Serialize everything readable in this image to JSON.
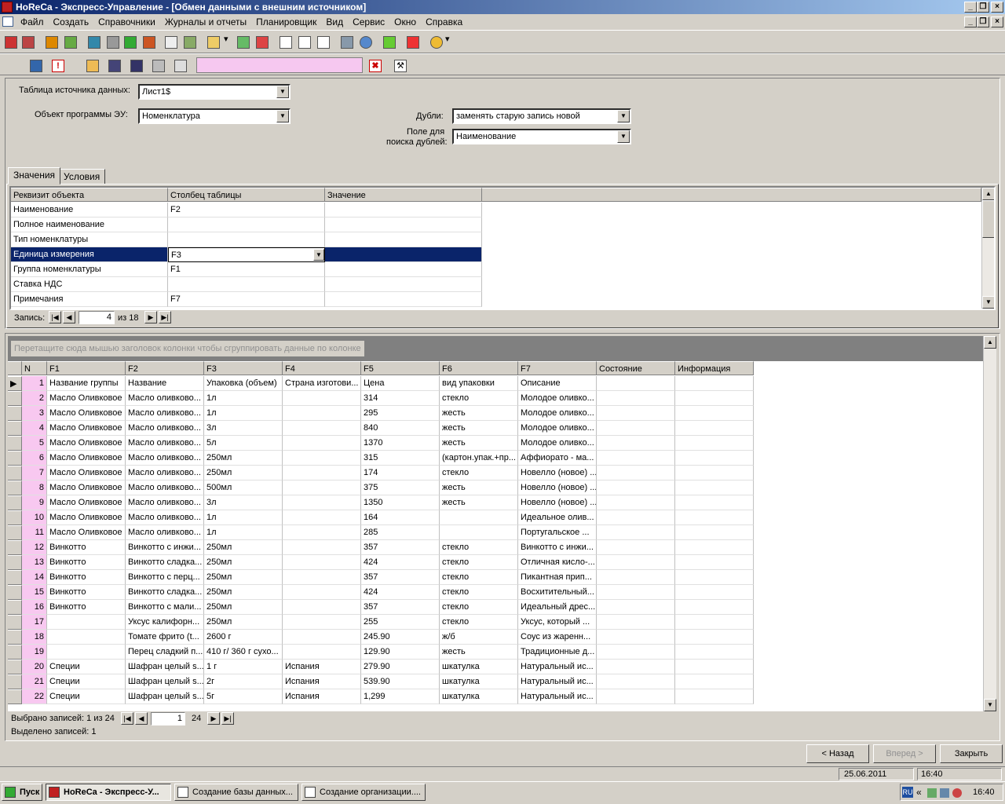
{
  "window": {
    "title": "HoReCa - Экспресс-Управление - [Обмен данными с внешним источником]"
  },
  "menu": [
    "Файл",
    "Создать",
    "Справочники",
    "Журналы и отчеты",
    "Планировщик",
    "Вид",
    "Сервис",
    "Окно",
    "Справка"
  ],
  "form": {
    "source_table_label": "Таблица источника данных:",
    "source_table_value": "Лист1$",
    "object_label": "Объект программы ЭУ:",
    "object_value": "Номенклатура",
    "dupes_label": "Дубли:",
    "dupes_value": "заменять старую запись новой",
    "dupe_field_label_1": "Поле для",
    "dupe_field_label_2": "поиска дублей:",
    "dupe_field_value": "Наименование"
  },
  "tabs": [
    "Значения",
    "Условия"
  ],
  "mapping": {
    "headers": [
      "Реквизит объекта",
      "Столбец таблицы",
      "Значение"
    ],
    "rows": [
      [
        "Наименование",
        "F2",
        ""
      ],
      [
        "Полное наименование",
        "",
        ""
      ],
      [
        "Тип номенклатуры",
        "",
        ""
      ],
      [
        "Единица измерения",
        "F3",
        ""
      ],
      [
        "Группа номенклатуры",
        "F1",
        ""
      ],
      [
        "Ставка НДС",
        "",
        ""
      ],
      [
        "Примечания",
        "F7",
        ""
      ]
    ],
    "nav_label": "Запись:",
    "nav_current": "4",
    "nav_total": "из 18"
  },
  "data_grid": {
    "group_hint": "Перетащите сюда мышью заголовок колонки чтобы сгруппировать данные по колонке",
    "headers": [
      "N",
      "F1",
      "F2",
      "F3",
      "F4",
      "F5",
      "F6",
      "F7",
      "Состояние",
      "Информация"
    ],
    "rows": [
      [
        "1",
        "Название группы",
        "Название",
        "Упаковка (объем)",
        "Страна изготови...",
        "Цена",
        "вид упаковки",
        "Описание"
      ],
      [
        "2",
        "Масло Оливковое",
        "Масло оливково...",
        "1л",
        "",
        "314",
        "стекло",
        "Молодое оливко..."
      ],
      [
        "3",
        "Масло Оливковое",
        "Масло оливково...",
        "1л",
        "",
        "295",
        "жесть",
        "Молодое оливко..."
      ],
      [
        "4",
        "Масло Оливковое",
        "Масло оливково...",
        "3л",
        "",
        "840",
        "жесть",
        "Молодое оливко..."
      ],
      [
        "5",
        "Масло Оливковое",
        "Масло оливково...",
        "5л",
        "",
        "1370",
        "жесть",
        "Молодое оливко..."
      ],
      [
        "6",
        "Масло Оливковое",
        "Масло оливково...",
        "250мл",
        "",
        "315",
        "(картон.упак.+пр...",
        "Аффиорато - ма..."
      ],
      [
        "7",
        "Масло Оливковое",
        "Масло оливково...",
        "250мл",
        "",
        "174",
        "стекло",
        "Новелло (новое) ..."
      ],
      [
        "8",
        "Масло Оливковое",
        "Масло оливково...",
        "500мл",
        "",
        "375",
        "жесть",
        "Новелло (новое) ..."
      ],
      [
        "9",
        "Масло Оливковое",
        "Масло оливково...",
        "3л",
        "",
        "1350",
        "жесть",
        "Новелло (новое) ..."
      ],
      [
        "10",
        "Масло Оливковое",
        "Масло оливково...",
        "1л",
        "",
        "164",
        "",
        "Идеальное олив..."
      ],
      [
        "11",
        "Масло Оливковое",
        "Масло оливково...",
        "1л",
        "",
        "285",
        "",
        "Португальское ..."
      ],
      [
        "12",
        "Винкотто",
        "Винкотто с инжи...",
        "250мл",
        "",
        "357",
        "стекло",
        "Винкотто с инжи..."
      ],
      [
        "13",
        "Винкотто",
        "Винкотто сладка...",
        "250мл",
        "",
        "424",
        "стекло",
        "Отличная кисло-..."
      ],
      [
        "14",
        "Винкотто",
        "Винкотто с перц...",
        "250мл",
        "",
        "357",
        "стекло",
        "Пикантная прип..."
      ],
      [
        "15",
        "Винкотто",
        "Винкотто сладка...",
        "250мл",
        "",
        "424",
        "стекло",
        "Восхитительный..."
      ],
      [
        "16",
        "Винкотто",
        "Винкотто с мали...",
        "250мл",
        "",
        "357",
        "стекло",
        "Идеальный дрес..."
      ],
      [
        "17",
        "",
        "Уксус калифорн...",
        "250мл",
        "",
        "255",
        "стекло",
        "Уксус, который ..."
      ],
      [
        "18",
        "",
        "Томате фрито (t...",
        "2600 г",
        "",
        "245.90",
        "ж/б",
        "Соус из жаренн..."
      ],
      [
        "19",
        "",
        "Перец сладкий п...",
        "410 г/ 360 г сухо...",
        "",
        "129.90",
        "жесть",
        "Традиционные д..."
      ],
      [
        "20",
        "Специи",
        "Шафран целый s...",
        "1 г",
        "Испания",
        "279.90",
        "шкатулка",
        "Натуральный ис..."
      ],
      [
        "21",
        "Специи",
        "Шафран целый s...",
        "2г",
        "Испания",
        "539.90",
        "шкатулка",
        "Натуральный ис..."
      ],
      [
        "22",
        "Специи",
        "Шафран целый s...",
        "5г",
        "Испания",
        "1,299",
        "шкатулка",
        "Натуральный ис..."
      ]
    ],
    "selected_label": "Выбрано записей: 1 из 24",
    "nav_current": "1",
    "nav_total": "24",
    "status": "Выделено записей: 1"
  },
  "buttons": {
    "back": "< Назад",
    "forward": "Вперед >",
    "close": "Закрыть"
  },
  "statusbar": {
    "date": "25.06.2011",
    "time": "16:40"
  },
  "taskbar": {
    "start": "Пуск",
    "items": [
      "HoReCa - Экспресс-У...",
      "Создание базы данных...",
      "Создание организации...."
    ],
    "lang": "RU",
    "clock": "16:40"
  }
}
